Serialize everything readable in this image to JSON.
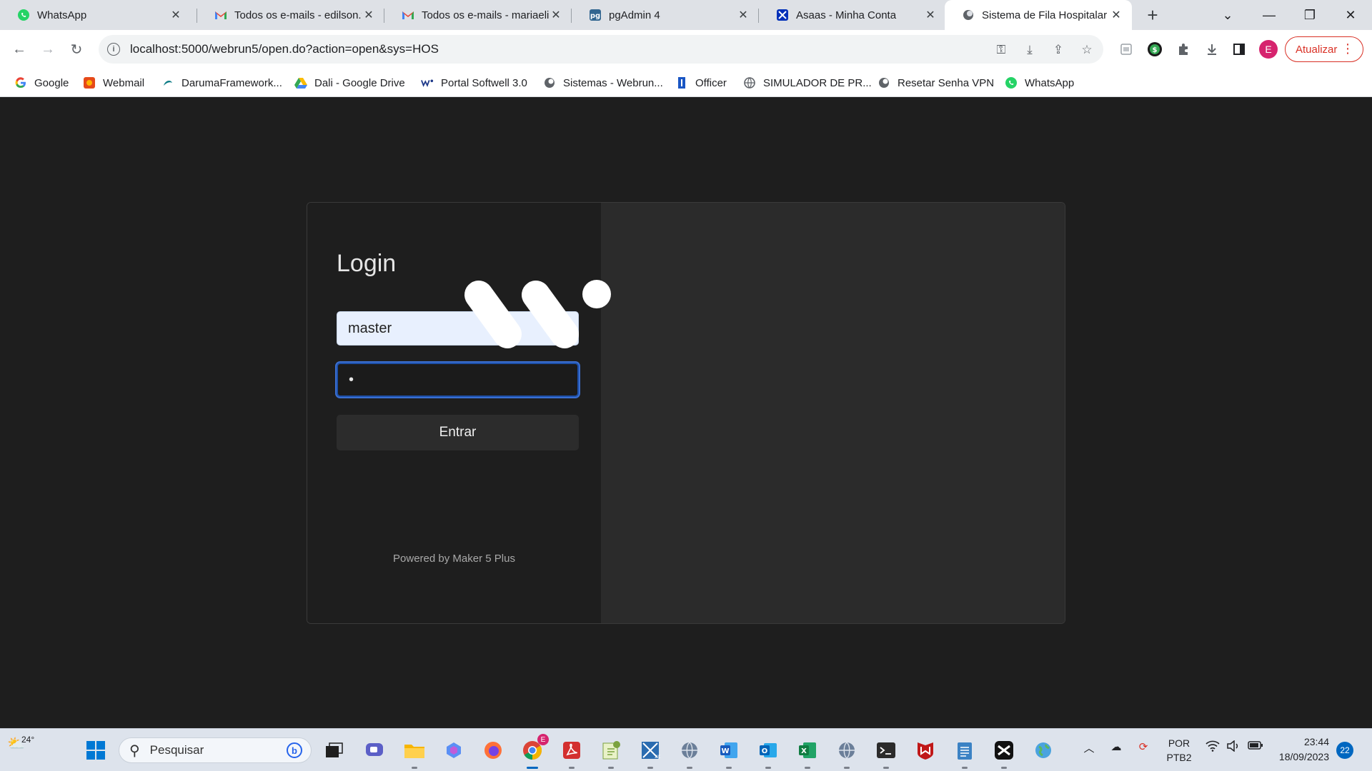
{
  "browser": {
    "tabs": [
      {
        "title": "WhatsApp",
        "icon": "whatsapp-icon",
        "active": false
      },
      {
        "title": "Todos os e-mails - edilson.t",
        "icon": "gmail-icon",
        "active": false
      },
      {
        "title": "Todos os e-mails - mariaelia",
        "icon": "gmail-icon",
        "active": false
      },
      {
        "title": "pgAdmin 4",
        "icon": "pgadmin-icon",
        "active": false
      },
      {
        "title": "Asaas - Minha Conta",
        "icon": "asaas-icon",
        "active": false
      },
      {
        "title": "Sistema de Fila Hospitalar",
        "icon": "webrun-icon",
        "active": true
      }
    ],
    "url": "localhost:5000/webrun5/open.do?action=open&sys=HOS",
    "profile_initial": "E",
    "update_label": "Atualizar",
    "bookmarks": [
      {
        "label": "Google",
        "icon": "google-icon"
      },
      {
        "label": "Webmail",
        "icon": "webmail-icon"
      },
      {
        "label": "DarumaFramework...",
        "icon": "daruma-icon"
      },
      {
        "label": "Dali - Google Drive",
        "icon": "google-drive-icon"
      },
      {
        "label": "Portal Softwell 3.0",
        "icon": "softwell-icon"
      },
      {
        "label": "Sistemas - Webrun...",
        "icon": "webrun-icon"
      },
      {
        "label": "Officer",
        "icon": "officer-icon"
      },
      {
        "label": "SIMULADOR DE PR...",
        "icon": "globe-icon"
      },
      {
        "label": "Resetar Senha VPN",
        "icon": "webrun-icon"
      },
      {
        "label": "WhatsApp",
        "icon": "whatsapp-icon"
      }
    ],
    "colors": {
      "tabbar": "#dee1e6",
      "update_accent": "#d93025",
      "avatar": "#d6246e"
    }
  },
  "login": {
    "title": "Login",
    "username_value": "master",
    "password_mask": "•",
    "submit_label": "Entrar",
    "footer": "Powered by Maker 5 Plus",
    "colors": {
      "background": "#1e1e1e",
      "panel_right": "#2b2b2b",
      "focus_ring": "#3b6fd0"
    }
  },
  "taskbar": {
    "weather_temp": "24°",
    "search_placeholder": "Pesquisar",
    "lang_line1": "POR",
    "lang_line2": "PTB2",
    "time": "23:44",
    "date": "18/09/2023",
    "notifications": "22",
    "chrome_badge": "E"
  }
}
